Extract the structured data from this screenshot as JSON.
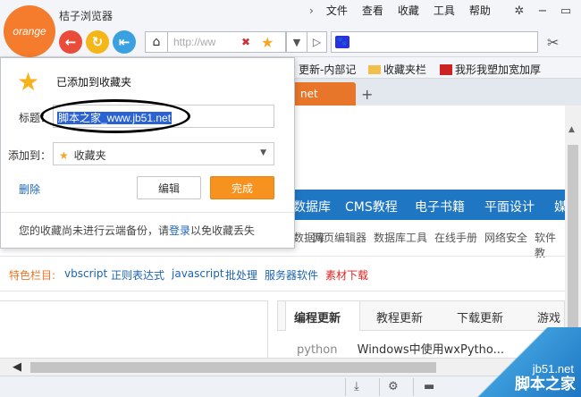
{
  "app": {
    "name": "桔子浏览器",
    "logo_text": "orange"
  },
  "menu": {
    "items": [
      "文件",
      "查看",
      "收藏",
      "工具",
      "帮助"
    ]
  },
  "toolbar": {
    "url_placeholder": "http://ww"
  },
  "bookmarks_bar": {
    "items": [
      "更新-内部记",
      "收藏夹栏",
      "我形我塑加宽加厚"
    ]
  },
  "tabs": {
    "active_label": "net"
  },
  "page": {
    "nav": [
      "数据库",
      "CMS教程",
      "电子书籍",
      "平面设计",
      "媒"
    ],
    "subnav": [
      "数据库",
      "网页编辑器",
      "数据库工具",
      "在线手册",
      "网络安全",
      "软件教"
    ],
    "featured_label": "特色栏目:",
    "featured": [
      "vbscript",
      "正则表达式",
      "javascript",
      "批处理",
      "服务器软件",
      "素材下载"
    ],
    "section_tabs": [
      "编程更新",
      "教程更新",
      "下载更新",
      "游戏"
    ],
    "article_cat": "python",
    "article_title": "Windows中使用wxPytho..."
  },
  "popup": {
    "header": "已添加到收藏夹",
    "title_label": "标题：",
    "title_value": "脚本之家_www.jb51.net",
    "folder_label": "添加到：",
    "folder_value": "收藏夹",
    "delete_label": "删除",
    "edit_label": "编辑",
    "done_label": "完成",
    "footer_prefix": "您的收藏尚未进行云端备份，请",
    "footer_link": "登录",
    "footer_suffix": "以免收藏丢失"
  },
  "watermark": {
    "site": "jb51.net",
    "name": "脚本之家"
  },
  "colors": {
    "accent": "#f7921e",
    "nav_blue": "#1f76c2",
    "link": "#1b64b5"
  }
}
